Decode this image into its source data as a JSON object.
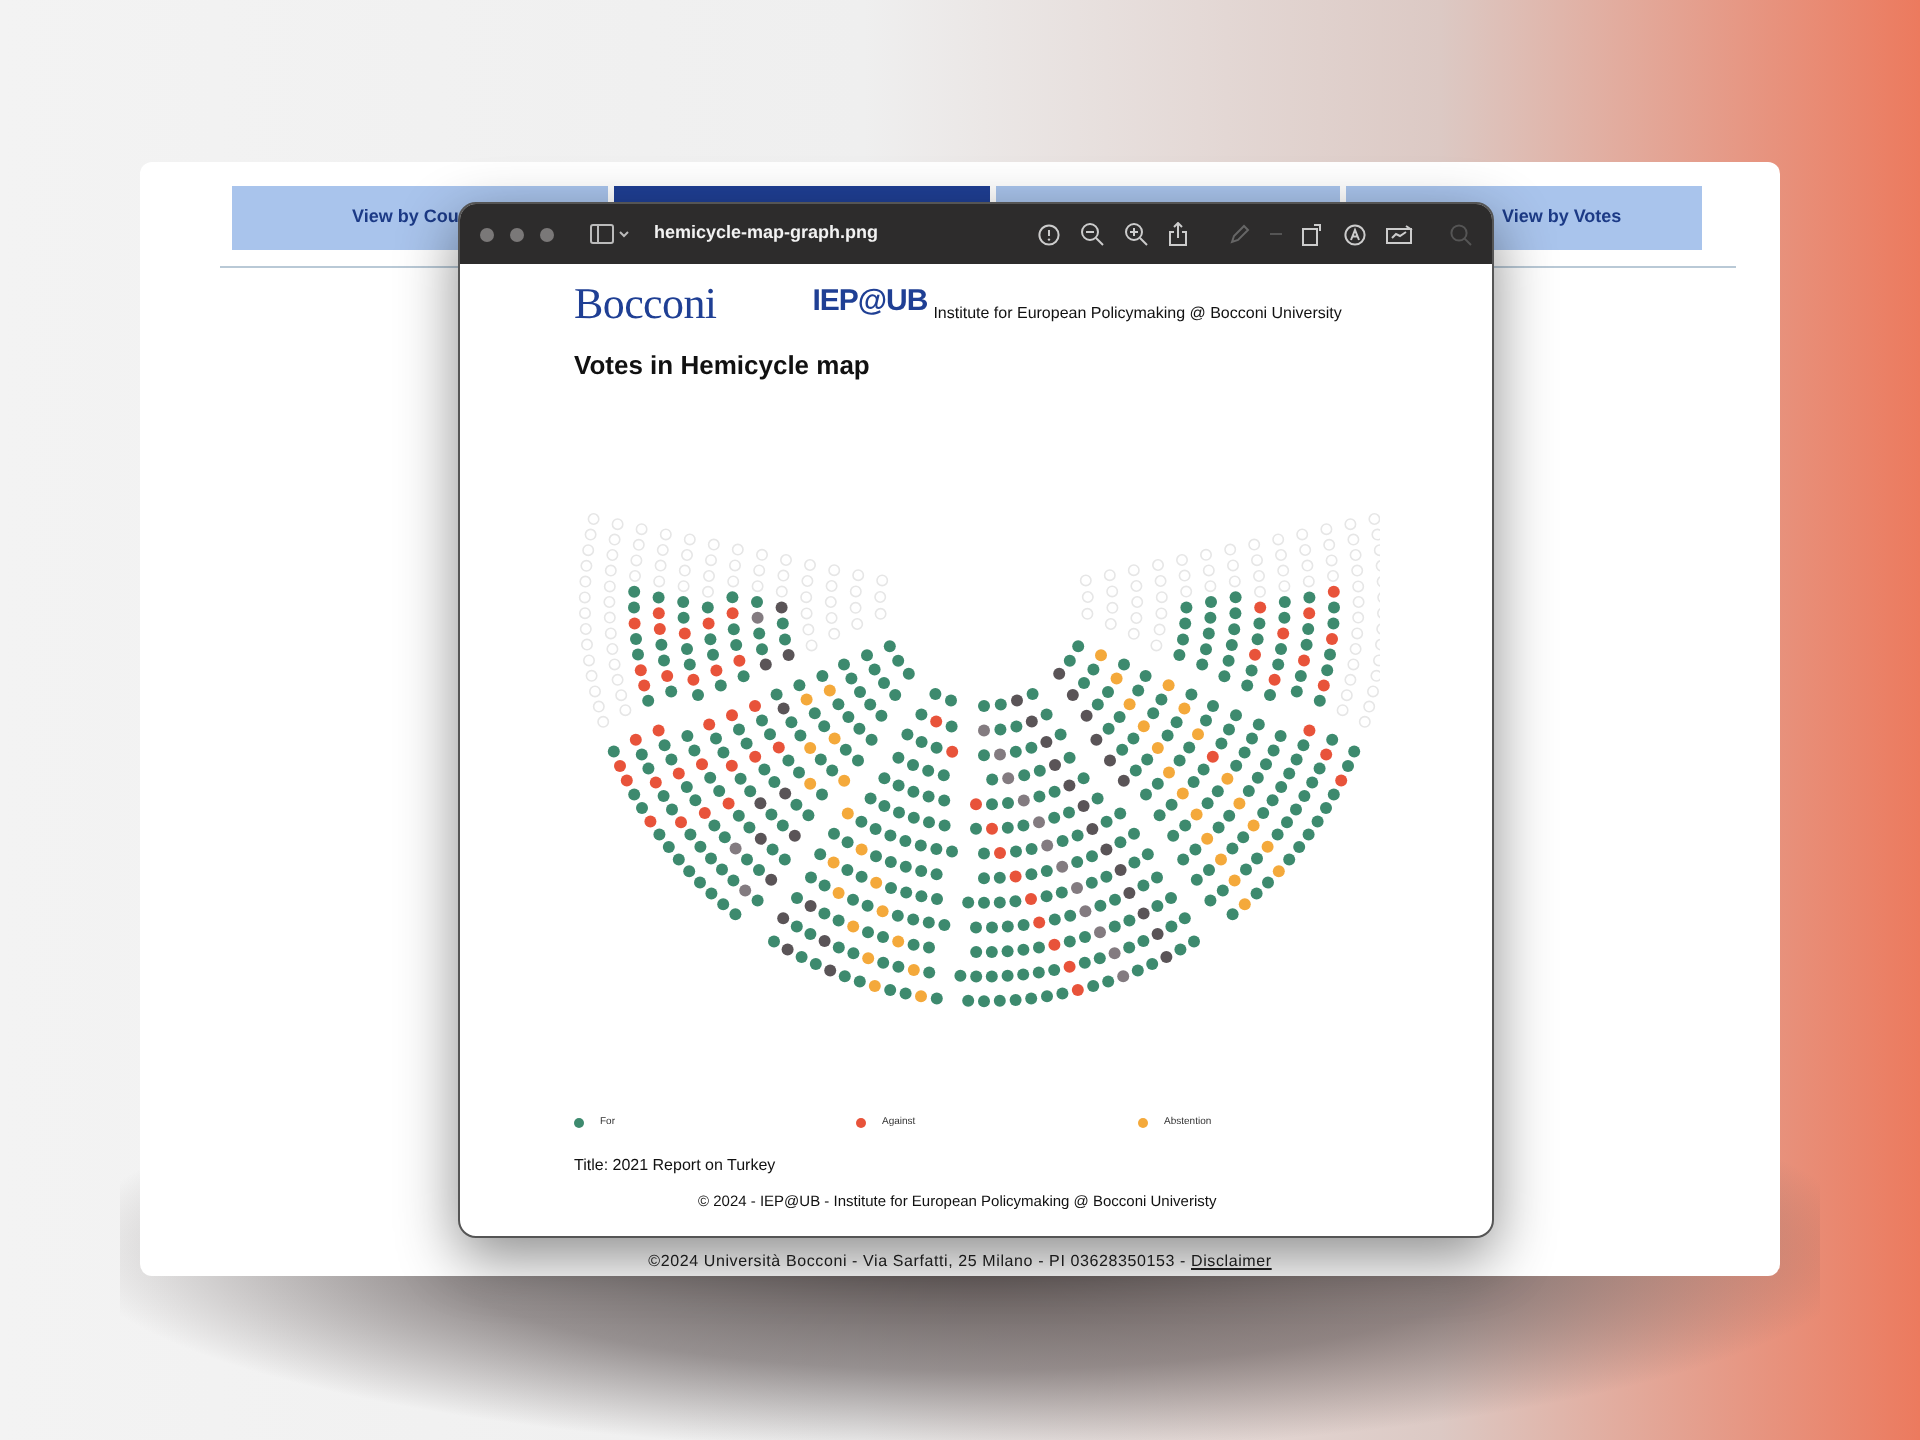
{
  "site": {
    "tabs": [
      {
        "label": "View by Cou",
        "selected": false
      },
      {
        "selected": true
      },
      {
        "selected": false
      },
      {
        "label": "View by Votes",
        "selected": false
      }
    ],
    "footer": {
      "text": "©2024 Università Bocconi - Via Sarfatti, 25 Milano - PI 03628350153 - ",
      "link": "Disclaimer"
    }
  },
  "viewer": {
    "title": "hemicycle-map-graph.png",
    "image": {
      "logo": "Bocconi",
      "institute_logo": "IEP@UB",
      "institute_name": "Institute for European Policymaking @ Bocconi University",
      "heading": "Votes in Hemicycle map",
      "legend": [
        {
          "label": "For",
          "color": "#3d8a6e"
        },
        {
          "label": "Against",
          "color": "#e8533a"
        },
        {
          "label": "Abstention",
          "color": "#f4a93b"
        }
      ],
      "caption": "Title: 2021 Report on Turkey",
      "credit": "© 2024 - IEP@UB - Institute for European Policymaking @ Bocconi Univeristy"
    }
  }
}
